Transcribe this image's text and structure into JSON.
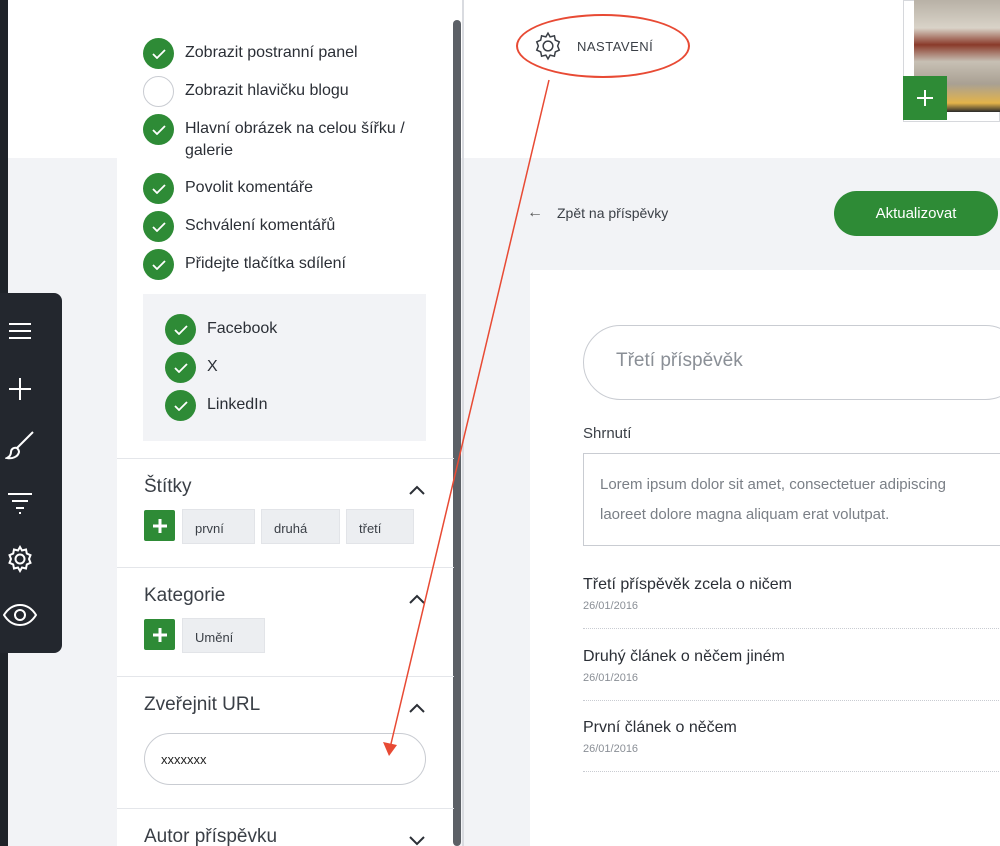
{
  "settings_options": [
    {
      "label": "Zobrazit postranní panel",
      "checked": true
    },
    {
      "label": "Zobrazit hlavičku blogu",
      "checked": false
    },
    {
      "label": "Hlavní obrázek na celou šířku / galerie",
      "checked": true
    },
    {
      "label": "Povolit komentáře",
      "checked": true
    },
    {
      "label": "Schválení komentářů",
      "checked": true
    },
    {
      "label": "Přidejte tlačítka sdílení",
      "checked": true
    }
  ],
  "share_options": [
    {
      "label": "Facebook",
      "checked": true
    },
    {
      "label": "X",
      "checked": true
    },
    {
      "label": "LinkedIn",
      "checked": true
    }
  ],
  "tags_section": {
    "title": "Štítky",
    "tags": [
      "první",
      "druhá",
      "třetí"
    ]
  },
  "categories_section": {
    "title": "Kategorie",
    "items": [
      "Umění"
    ]
  },
  "url_section": {
    "title": "Zveřejnit URL",
    "value": "xxxxxxx"
  },
  "author_section": {
    "title": "Autor příspěvku"
  },
  "settings_link": {
    "label": "NASTAVENÍ"
  },
  "back_link": {
    "label": "Zpět na příspěvky"
  },
  "update_button": {
    "label": "Aktualizovat"
  },
  "post_title_field": {
    "value": "Třetí příspěvěk"
  },
  "summary": {
    "label": "Shrnutí",
    "line1": "Lorem ipsum dolor sit amet, consectetuer adipiscing",
    "line2": "laoreet dolore magna aliquam erat volutpat."
  },
  "posts": [
    {
      "title": "Třetí příspěvěk zcela o ničem",
      "date": "26/01/2016"
    },
    {
      "title": "Druhý článek o něčem jiném",
      "date": "26/01/2016"
    },
    {
      "title": "První článek o něčem",
      "date": "26/01/2016"
    }
  ],
  "colors": {
    "accent": "#2e8b36",
    "annotation": "#e84a34",
    "toolbar": "#23272e"
  },
  "toolbar_icons": [
    "menu-icon",
    "plus-icon",
    "brush-icon",
    "filter-icon",
    "gear-icon",
    "eye-icon"
  ]
}
